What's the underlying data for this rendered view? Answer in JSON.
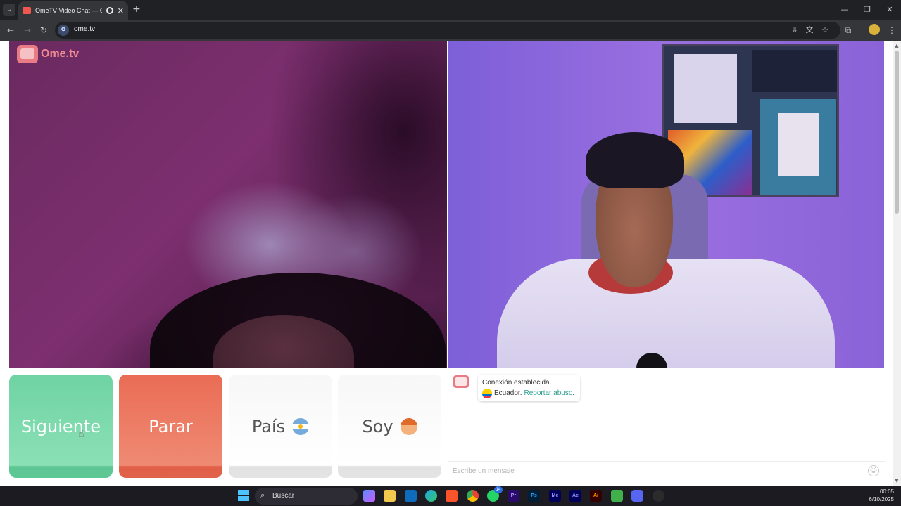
{
  "browser": {
    "tab_title": "OmeTV Video Chat — Ome",
    "new_tab": "+",
    "tab_close": "✕",
    "url": "ome.tv",
    "window_controls": {
      "minimize": "—",
      "restore": "❐",
      "close": "✕"
    },
    "icons": [
      "back-icon",
      "forward-icon",
      "reload-icon",
      "install-icon",
      "translate-icon",
      "star-icon",
      "extensions-icon",
      "profile-icon",
      "menu-icon"
    ]
  },
  "logo": {
    "text": "Ome.tv"
  },
  "buttons": {
    "next": "Siguiente",
    "stop": "Parar",
    "country": "País",
    "gender": "Soy"
  },
  "chat": {
    "status": "Conexión establecida.",
    "country": "Ecuador.",
    "report_link": "Reportar abuso",
    "report_suffix": ".",
    "input_placeholder": "Escribe un mensaje"
  },
  "taskbar": {
    "search_label": "Buscar",
    "badge_count": "14",
    "apps": [
      "Pr",
      "Ps",
      "Me",
      "Ae",
      "Ai"
    ],
    "time": "00:05",
    "date": "6/10/2025"
  },
  "colors": {
    "next_button": "#6fd3a3",
    "stop_button": "#ea6c55",
    "report_link": "#2a9d8f",
    "logo": "#ee8a92"
  }
}
